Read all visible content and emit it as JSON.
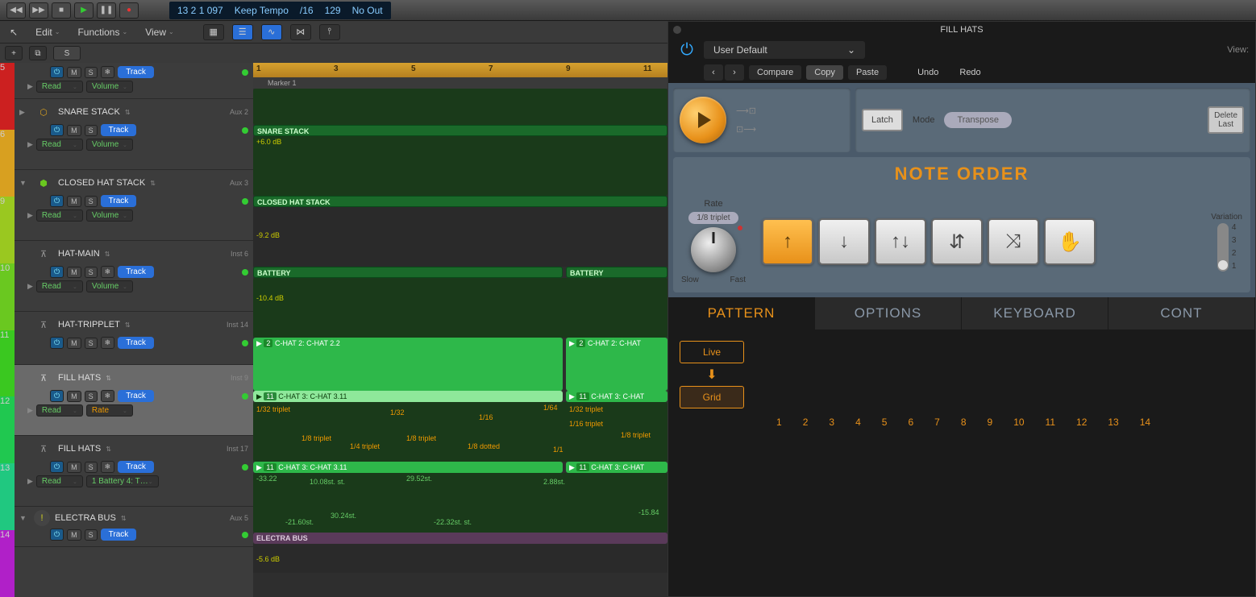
{
  "transport": {
    "position": "13 2 1 097",
    "tempo_mode": "Keep Tempo",
    "time_sig": "/16",
    "tempo": "129",
    "output": "No Out"
  },
  "menus": {
    "edit": "Edit",
    "functions": "Functions",
    "view": "View"
  },
  "sec_bar": {
    "solo": "S"
  },
  "ruler": {
    "marks": [
      "1",
      "3",
      "5",
      "7",
      "9",
      "11"
    ],
    "marker": "Marker 1"
  },
  "tracks": [
    {
      "name": "",
      "sub": "",
      "auto": "Read",
      "param": "Volume",
      "btn": "Track",
      "color": "#cc2020"
    },
    {
      "name": "SNARE STACK",
      "sub": "Aux 2",
      "auto": "Read",
      "param": "Volume",
      "btn": "Track",
      "color": "#c8b020",
      "region": "SNARE STACK",
      "db": "+6.0 dB"
    },
    {
      "name": "CLOSED HAT STACK",
      "sub": "Aux 3",
      "auto": "Read",
      "param": "Volume",
      "btn": "Track",
      "color": "#6ac820",
      "region": "CLOSED HAT STACK",
      "db": "-9.2 dB"
    },
    {
      "name": "HAT-MAIN",
      "sub": "Inst 6",
      "auto": "Read",
      "param": "Volume",
      "btn": "Track",
      "color": "#3ac820",
      "region": "BATTERY",
      "region2": "BATTERY",
      "db": "-10.4 dB"
    },
    {
      "name": "HAT-TRIPPLET",
      "sub": "Inst 14",
      "auto": "",
      "param": "",
      "btn": "Track",
      "color": "#20c850",
      "region": "C-HAT 2: C-HAT 2.2",
      "region2": "C-HAT 2: C-HAT",
      "region_n": "2",
      "region2_n": "2"
    },
    {
      "name": "FILL HATS",
      "sub": "Inst 9",
      "auto": "Read",
      "param": "Rate",
      "btn": "Track",
      "color": "#20c880",
      "region": "C-HAT 3: C-HAT 3.11",
      "region2": "C-HAT 3: C-HAT",
      "region_n": "11",
      "region2_n": "11",
      "selected": true,
      "autolabels": [
        "1/32 triplet",
        "1/32",
        "1/16",
        "1/64",
        "1/32 triplet",
        "1/8 triplet",
        "1/4 triplet",
        "1/8 triplet",
        "1/8 dotted",
        "1/1",
        "1/16 triplet",
        "1/8 triplet"
      ]
    },
    {
      "name": "FILL HATS",
      "sub": "Inst 17",
      "auto": "Read",
      "param": "1 Battery 4: T…",
      "btn": "Track",
      "color": "#20c8b0",
      "region": "C-HAT 3: C-HAT 3.11",
      "region2": "C-HAT 3: C-HAT",
      "region_n": "11",
      "region2_n": "11",
      "autolabels2": [
        "-33.22",
        "10.08st. st.",
        "-21.60st.",
        "30.24st.",
        "29.52st.",
        "-22.32st. st.",
        "2.88st.",
        "-15.84"
      ]
    },
    {
      "name": "ELECTRA BUS",
      "sub": "Aux 5",
      "auto": "",
      "param": "",
      "btn": "Track",
      "color": "#b020c8",
      "region": "ELECTRA BUS",
      "db": "-5.6 dB"
    }
  ],
  "color_segs": [
    "#cc2020",
    "#d87020",
    "#c8b020",
    "#9ac820",
    "#6ac820",
    "#3ac820",
    "#20c850",
    "#20c880",
    "#20c8b0",
    "#b020c8"
  ],
  "plugin": {
    "title": "FILL HATS",
    "preset": "User Default",
    "compare": "Compare",
    "copy": "Copy",
    "paste": "Paste",
    "undo": "Undo",
    "redo": "Redo",
    "view": "View:",
    "latch": "Latch",
    "mode_label": "Mode",
    "mode_value": "Transpose",
    "delete_last": "Delete\nLast",
    "note_order": "NOTE ORDER",
    "rate_label": "Rate",
    "rate_value": "1/8 triplet",
    "slow": "Slow",
    "fast": "Fast",
    "variation": "Variation",
    "var_marks": [
      "4",
      "3",
      "2",
      "1"
    ],
    "order_icons": [
      "↑",
      "↓",
      "↑↓",
      "⇵",
      "⤨",
      "✋"
    ],
    "tabs": [
      "PATTERN",
      "OPTIONS",
      "KEYBOARD",
      "CONT"
    ],
    "live": "Live",
    "grid": "Grid",
    "steps": [
      "1",
      "2",
      "3",
      "4",
      "5",
      "6",
      "7",
      "8",
      "9",
      "10",
      "11",
      "12",
      "13",
      "14"
    ]
  }
}
